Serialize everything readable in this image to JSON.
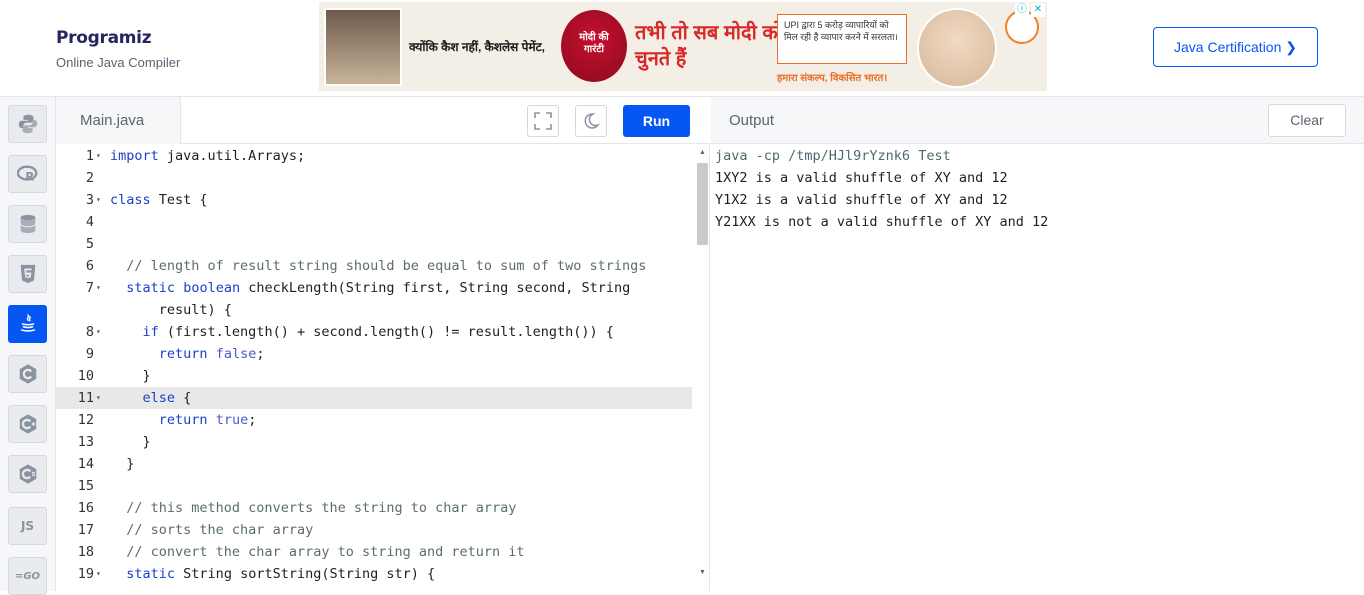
{
  "header": {
    "logo_text": "Programiz",
    "logo_subtitle": "Online Java Compiler",
    "cert_button": "Java Certification ❯"
  },
  "ad": {
    "text1": "क्योंकि कैश नहीं, कैशलेस पेमेंट,",
    "seal": "मोदी की गारंटी",
    "headline": "तभी तो सब मोदी को चुनते हैं",
    "box": "UPI द्वारा 5 करोड़ व्यापारियों को मिल रही है व्यापार करने में सरलता।",
    "tag": "हमारा संकल्प, विकसित भारत।",
    "info_icon": "ⓘ",
    "close_icon": "✕"
  },
  "sidebar": {
    "items": [
      {
        "name": "python",
        "icon": "python-icon"
      },
      {
        "name": "r",
        "icon": "r-icon"
      },
      {
        "name": "sql",
        "icon": "database-icon"
      },
      {
        "name": "html",
        "icon": "html5-icon"
      },
      {
        "name": "java",
        "icon": "java-icon",
        "active": true
      },
      {
        "name": "c",
        "icon": "c-icon"
      },
      {
        "name": "cpp",
        "icon": "cpp-icon"
      },
      {
        "name": "csharp",
        "icon": "csharp-icon"
      },
      {
        "name": "js",
        "label": "JS"
      },
      {
        "name": "go",
        "label": "=GO"
      }
    ]
  },
  "editor": {
    "file_tab": "Main.java",
    "run_label": "Run",
    "lines": [
      {
        "n": "1",
        "fold": true,
        "html": "<span class='kw'>import</span> java.util.Arrays;"
      },
      {
        "n": "2",
        "html": ""
      },
      {
        "n": "3",
        "fold": true,
        "html": "<span class='kw'>class</span> Test {"
      },
      {
        "n": "4",
        "html": ""
      },
      {
        "n": "5",
        "html": ""
      },
      {
        "n": "6",
        "html": "  <span class='cm'>// length of result string should be equal to sum of two strings</span>"
      },
      {
        "n": "7",
        "fold": true,
        "html": "  <span class='kw'>static</span> <span class='kw'>boolean</span> checkLength(String first, String second, String"
      },
      {
        "n": "",
        "html": "      result) {"
      },
      {
        "n": "8",
        "fold": true,
        "html": "    <span class='kw'>if</span> (first.length() + second.length() != result.length()) {"
      },
      {
        "n": "9",
        "html": "      <span class='kw'>return</span> <span class='lit'>false</span>;"
      },
      {
        "n": "10",
        "html": "    }"
      },
      {
        "n": "11",
        "fold": true,
        "active": true,
        "html": "    <span class='kw'>else</span> {"
      },
      {
        "n": "12",
        "html": "      <span class='kw'>return</span> <span class='lit'>true</span>;"
      },
      {
        "n": "13",
        "html": "    }"
      },
      {
        "n": "14",
        "html": "  }"
      },
      {
        "n": "15",
        "html": ""
      },
      {
        "n": "16",
        "html": "  <span class='cm'>// this method converts the string to char array</span>"
      },
      {
        "n": "17",
        "html": "  <span class='cm'>// sorts the char array</span>"
      },
      {
        "n": "18",
        "html": "  <span class='cm'>// convert the char array to string and return it</span>"
      },
      {
        "n": "19",
        "fold": true,
        "html": "  <span class='kw'>static</span> String sortString(String str) {"
      }
    ]
  },
  "output": {
    "title": "Output",
    "clear_label": "Clear",
    "lines": [
      {
        "text": "java -cp /tmp/HJl9rYznk6 Test",
        "cmd": true
      },
      {
        "text": "1XY2 is a valid shuffle of XY and 12"
      },
      {
        "text": "Y1X2 is a valid shuffle of XY and 12"
      },
      {
        "text": "Y21XX is not a valid shuffle of XY and 12"
      }
    ]
  }
}
